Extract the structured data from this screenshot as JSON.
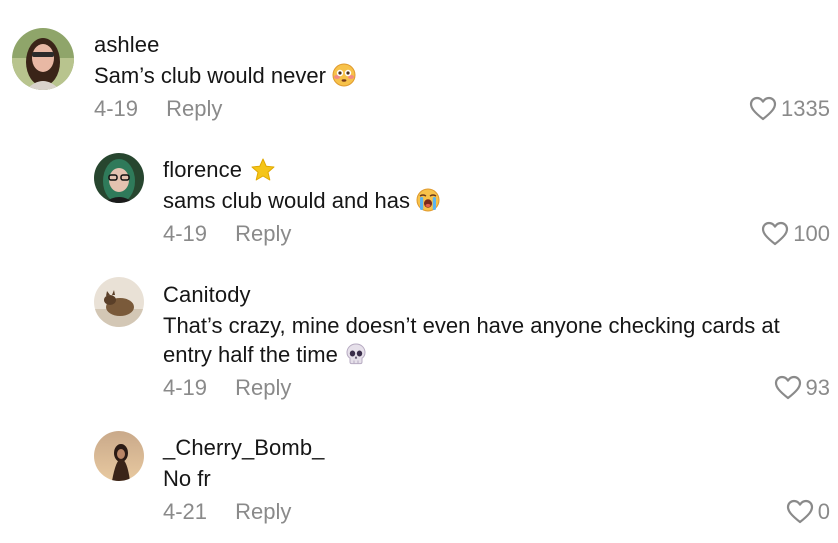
{
  "comments": [
    {
      "username": "ashlee",
      "text": "Sam’s club would never",
      "emoji": "flushed-face-emoji",
      "date": "4-19",
      "reply_label": "Reply",
      "likes": "1335"
    },
    {
      "username": "florence",
      "badge": "star-icon",
      "text": "sams club would and has",
      "emoji": "loudly-crying-face-emoji",
      "date": "4-19",
      "reply_label": "Reply",
      "likes": "100"
    },
    {
      "username": "Canitody",
      "text": "That’s crazy, mine doesn’t even have anyone checking cards at entry half the time",
      "emoji": "skull-emoji",
      "date": "4-19",
      "reply_label": "Reply",
      "likes": "93"
    },
    {
      "username": "_Cherry_Bomb_",
      "text": "No fr",
      "date": "4-21",
      "reply_label": "Reply",
      "likes": "0"
    }
  ],
  "colors": {
    "text": "#161616",
    "muted": "#8a8a8a",
    "star": "#f5c518"
  }
}
